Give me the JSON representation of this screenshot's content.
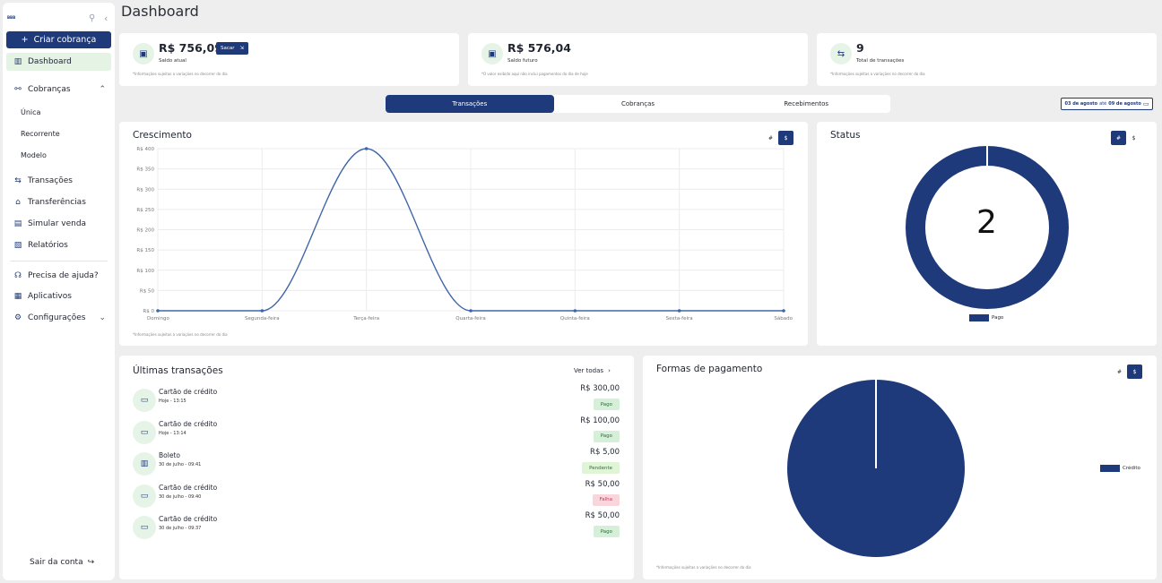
{
  "sidebar": {
    "logo": "BBB",
    "create_label": "Criar cobrança",
    "items": [
      {
        "label": "Dashboard"
      },
      {
        "label": "Cobranças"
      },
      {
        "label": "Transações"
      },
      {
        "label": "Transferências"
      },
      {
        "label": "Simular venda"
      },
      {
        "label": "Relatórios"
      },
      {
        "label": "Precisa de ajuda?"
      },
      {
        "label": "Aplicativos"
      },
      {
        "label": "Configurações"
      }
    ],
    "sub_items": [
      "Única",
      "Recorrente",
      "Modelo"
    ],
    "logout": "Sair da conta"
  },
  "header": {
    "title": "Dashboard"
  },
  "stats": [
    {
      "value": "R$ 756,09",
      "label": "Saldo atual",
      "note": "*Informações sujeitas a variações no decorrer do dia",
      "action": "Sacar"
    },
    {
      "value": "R$ 576,04",
      "label": "Saldo futuro",
      "note": "*O valor exibido aqui não inclui pagamentos do dia de hoje"
    },
    {
      "value": "9",
      "label": "Total de transações",
      "note": "*Informações sujeitas a variações no decorrer do dia"
    }
  ],
  "tabs": [
    "Transações",
    "Cobranças",
    "Recebimentos"
  ],
  "date_range": {
    "start": "03 de agosto",
    "mid": "até",
    "end": "09 de agosto"
  },
  "growth": {
    "title": "Crescimento",
    "toggle_count": "#",
    "toggle_value": "$",
    "note": "*Informações sujeitas a variações no decorrer do dia"
  },
  "status": {
    "title": "Status",
    "center_value": "2",
    "legend": "Pago",
    "toggle_count": "#",
    "toggle_value": "$"
  },
  "transactions": {
    "title": "Últimas transações",
    "view_all": "Ver todas",
    "rows": [
      {
        "name": "Cartão de crédito",
        "date": "Hoje - 13:15",
        "amount": "R$ 300,00",
        "status": "Pago",
        "icon": "card-icon"
      },
      {
        "name": "Cartão de crédito",
        "date": "Hoje - 13:14",
        "amount": "R$ 100,00",
        "status": "Pago",
        "icon": "card-icon"
      },
      {
        "name": "Boleto",
        "date": "30 de julho - 09:41",
        "amount": "R$ 5,00",
        "status": "Pendente",
        "icon": "barcode-icon"
      },
      {
        "name": "Cartão de crédito",
        "date": "30 de julho - 09:40",
        "amount": "R$ 50,00",
        "status": "Falha",
        "icon": "card-icon"
      },
      {
        "name": "Cartão de crédito",
        "date": "30 de julho - 09:37",
        "amount": "R$ 50,00",
        "status": "Pago",
        "icon": "card-icon"
      }
    ],
    "status_colors": {
      "Pago": "#d6efd8",
      "Pendente": "#dff5d6",
      "Falha": "#f9d6dc"
    }
  },
  "payments": {
    "title": "Formas de pagamento",
    "legend": "Crédito",
    "note": "*Informações sujeitas a variações no decorrer do dia",
    "toggle_count": "#",
    "toggle_value": "$"
  },
  "colors": {
    "primary": "#1e3a7b",
    "accent_bg": "#e6f4e7"
  },
  "chart_data": [
    {
      "type": "line",
      "categories": [
        "Domingo",
        "Segunda-feira",
        "Terça-feira",
        "Quarta-feira",
        "Quinta-feira",
        "Sexta-feira",
        "Sábado"
      ],
      "values": [
        0,
        0,
        400,
        0,
        0,
        0,
        0
      ],
      "ylim": [
        0,
        400
      ],
      "yticks": [
        "R$ 0",
        "R$ 50",
        "R$ 100",
        "R$ 150",
        "R$ 200",
        "R$ 250",
        "R$ 300",
        "R$ 350",
        "R$ 400"
      ],
      "grid": true
    },
    {
      "type": "pie",
      "categories": [
        "Pago"
      ],
      "values": [
        2
      ]
    },
    {
      "type": "pie",
      "categories": [
        "Crédito"
      ],
      "values": [
        1
      ]
    }
  ]
}
